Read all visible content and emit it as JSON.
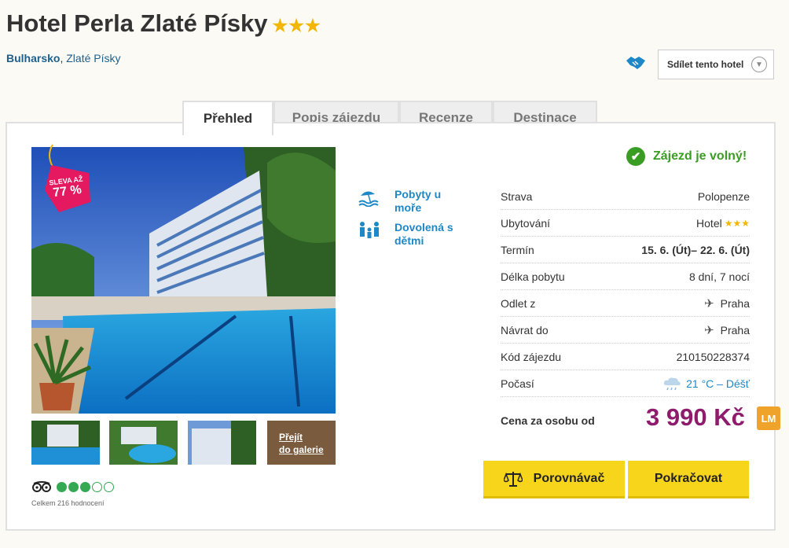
{
  "hotel": {
    "name": "Hotel Perla Zlaté Písky",
    "stars": "★★★"
  },
  "breadcrumb": {
    "country": "Bulharsko",
    "separator": ",",
    "resort": "Zlaté Písky"
  },
  "share": {
    "label": "Sdílet tento hotel",
    "icon": "handshake-icon"
  },
  "tabs": [
    {
      "label": "Přehled",
      "active": true
    },
    {
      "label": "Popis zájezdu"
    },
    {
      "label": "Recenze"
    },
    {
      "label": "Destinace"
    }
  ],
  "discount": {
    "line1": "SLEVA AŽ",
    "line2": "77 %"
  },
  "gallery": {
    "link_line1": "Přejít",
    "link_line2": "do galerie"
  },
  "rating": {
    "count_text": "Celkem 216 hodnocení",
    "score": 3,
    "max": 5,
    "icon": "tripadvisor-icon"
  },
  "features": [
    {
      "label": "Pobyty u moře",
      "icon": "beach-icon"
    },
    {
      "label": "Dovolená s dětmi",
      "icon": "family-icon"
    }
  ],
  "availability": "Zájezd je volný!",
  "info": {
    "board": {
      "label": "Strava",
      "value": "Polopenze"
    },
    "accommodation": {
      "label": "Ubytování",
      "value": "Hotel",
      "stars": "★★★"
    },
    "term": {
      "label": "Termín",
      "value": "15. 6. (Út)– 22. 6. (Út)"
    },
    "length": {
      "label": "Délka pobytu",
      "value": "8 dní, 7 nocí"
    },
    "departure": {
      "label": "Odlet z",
      "value": "Praha"
    },
    "return": {
      "label": "Návrat do",
      "value": "Praha"
    },
    "code": {
      "label": "Kód zájezdu",
      "value": "210150228374"
    },
    "weather": {
      "label": "Počasí",
      "value": "21 °C – Déšť"
    }
  },
  "price": {
    "label": "Cena za osobu od",
    "value": "3 990 Kč",
    "badge": "LM"
  },
  "buttons": {
    "compare": "Porovnávač",
    "continue": "Pokračovat"
  },
  "colors": {
    "accent_yellow": "#f7d51a",
    "price_purple": "#8e1b6b",
    "link_blue": "#1e88c7",
    "available_green": "#3a9d23",
    "star_gold": "#f2b705"
  }
}
